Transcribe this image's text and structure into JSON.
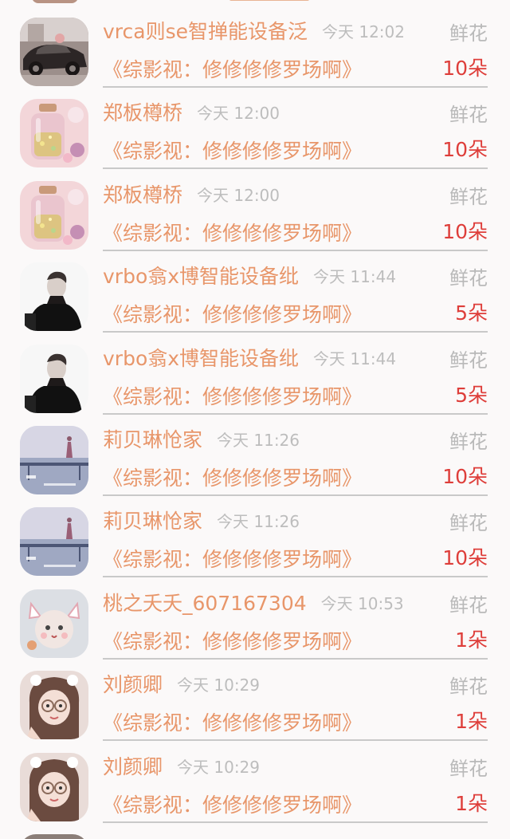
{
  "feed": {
    "items": [
      {
        "name": "vrca则se智掸能设备泛",
        "time": "今天 12:02",
        "gift_type": "鲜花",
        "message": "《综影视：修修修修罗场啊》",
        "count": "10朵",
        "avatar": "car"
      },
      {
        "name": "郑板樽桥",
        "time": "今天 12:00",
        "gift_type": "鲜花",
        "message": "《综影视：修修修修罗场啊》",
        "count": "10朵",
        "avatar": "bottle"
      },
      {
        "name": "郑板樽桥",
        "time": "今天 12:00",
        "gift_type": "鲜花",
        "message": "《综影视：修修修修罗场啊》",
        "count": "10朵",
        "avatar": "bottle"
      },
      {
        "name": "vrbo翕x博智能设备纰",
        "time": "今天 11:44",
        "gift_type": "鲜花",
        "message": "《综影视：修修修修罗场啊》",
        "count": "5朵",
        "avatar": "man"
      },
      {
        "name": "vrbo翕x博智能设备纰",
        "time": "今天 11:44",
        "gift_type": "鲜花",
        "message": "《综影视：修修修修罗场啊》",
        "count": "5朵",
        "avatar": "man"
      },
      {
        "name": "莉贝琳怆家",
        "time": "今天 11:26",
        "gift_type": "鲜花",
        "message": "《综影视：修修修修罗场啊》",
        "count": "10朵",
        "avatar": "seaside"
      },
      {
        "name": "莉贝琳怆家",
        "time": "今天 11:26",
        "gift_type": "鲜花",
        "message": "《综影视：修修修修罗场啊》",
        "count": "10朵",
        "avatar": "seaside"
      },
      {
        "name": "桃之夭夭_607167304",
        "time": "今天 10:53",
        "gift_type": "鲜花",
        "message": "《综影视：修修修修罗场啊》",
        "count": "1朵",
        "avatar": "cat"
      },
      {
        "name": "刘颜卿",
        "time": "今天 10:29",
        "gift_type": "鲜花",
        "message": "《综影视：修修修修罗场啊》",
        "count": "1朵",
        "avatar": "girl"
      },
      {
        "name": "刘颜卿",
        "time": "今天 10:29",
        "gift_type": "鲜花",
        "message": "《综影视：修修修修罗场啊》",
        "count": "1朵",
        "avatar": "girl"
      }
    ]
  },
  "colors": {
    "name": "#e8966a",
    "message": "#e8966a",
    "count": "#de3e3a",
    "secondary": "#b9b9b9",
    "divider": "#c9c9c9",
    "background": "#fbf9f9"
  }
}
